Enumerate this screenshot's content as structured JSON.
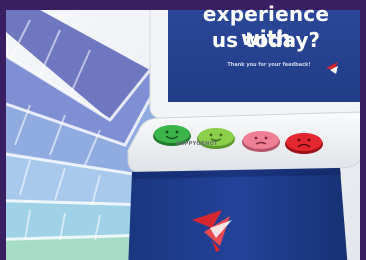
{
  "screen": {
    "headline_line1": "experience with",
    "headline_line2": "us today?",
    "thanks": "Thank you for your feedback!"
  },
  "device": {
    "brand": "HAPPYORNOT"
  },
  "buttons": [
    {
      "name": "very-happy",
      "color": "#3bb44a"
    },
    {
      "name": "happy",
      "color": "#8ccf4a"
    },
    {
      "name": "unhappy",
      "color": "#ef7f95"
    },
    {
      "name": "very-unhappy",
      "color": "#e3262f"
    }
  ],
  "colors": {
    "border": "#3a1e62",
    "screen_blue": "#26408f",
    "stand_blue": "#1e3b8a",
    "logo_red": "#d8262e",
    "swatch_tones": [
      "#7b84c9",
      "#8fa4dc",
      "#a7c6ec",
      "#9fd4e8",
      "#a9dcc8"
    ]
  }
}
